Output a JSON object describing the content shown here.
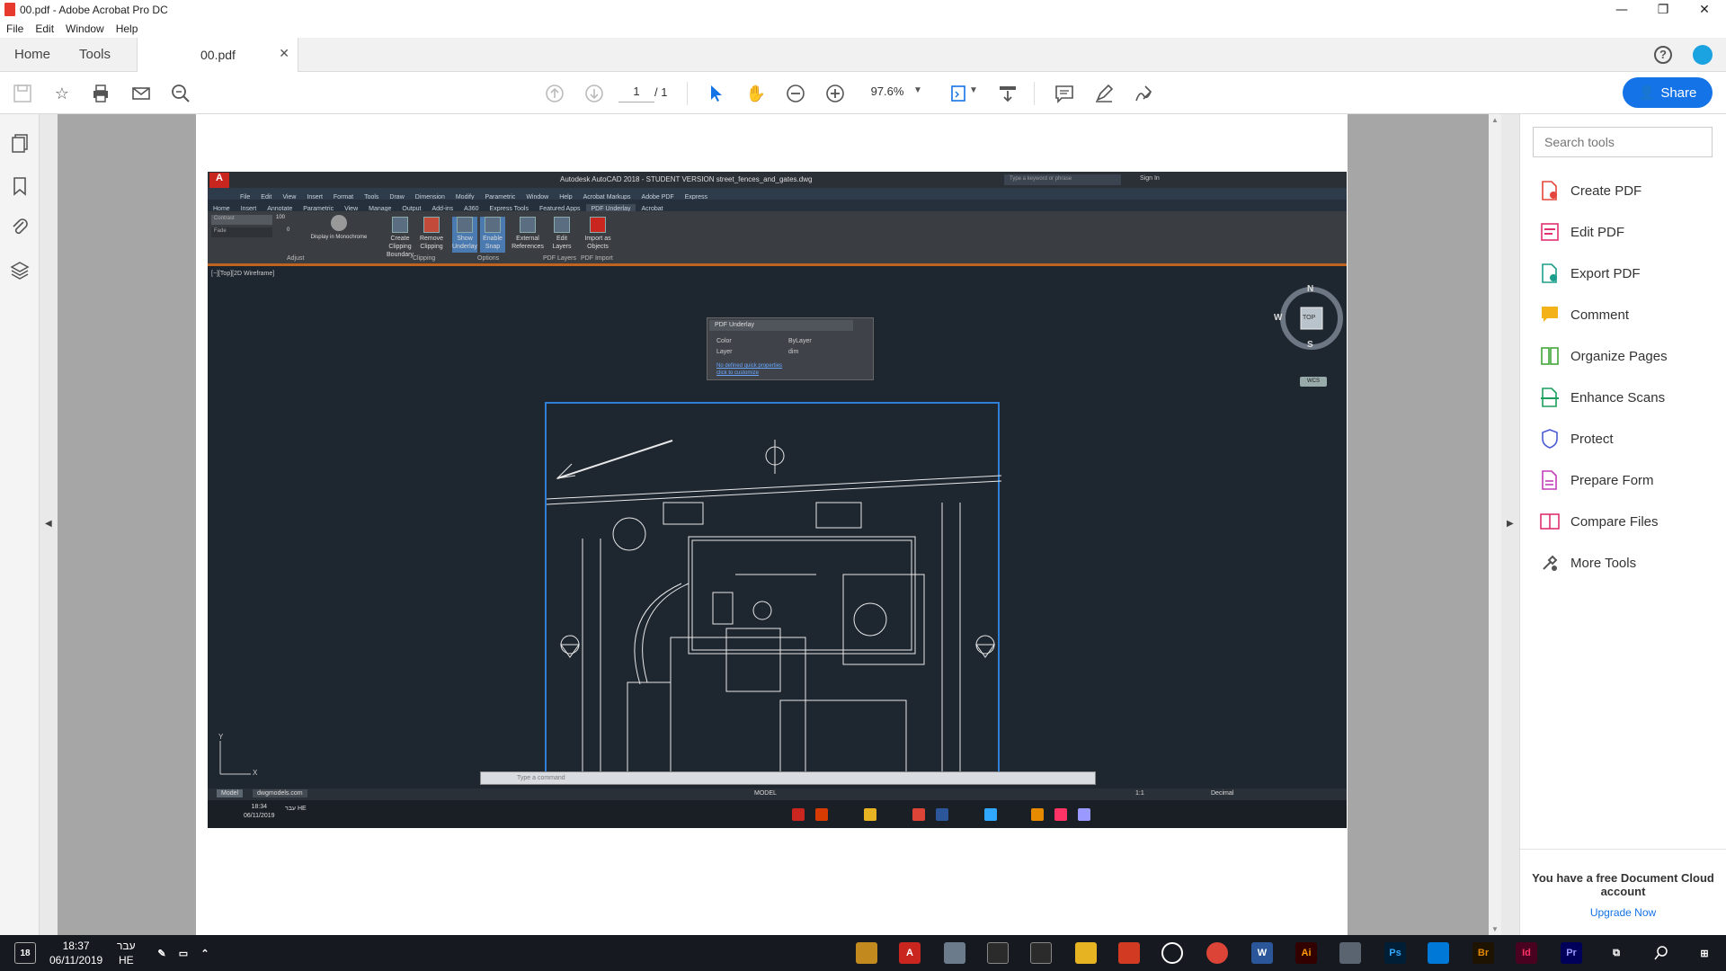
{
  "window": {
    "title": "00.pdf - Adobe Acrobat Pro DC"
  },
  "menu": [
    "File",
    "Edit",
    "Window",
    "Help"
  ],
  "tabs": {
    "home": "Home",
    "tools": "Tools",
    "document": "00.pdf"
  },
  "toolbar": {
    "page_current": "1",
    "page_total": "/ 1",
    "zoom": "97.6%",
    "share_label": "Share"
  },
  "tools_pane": {
    "search_placeholder": "Search tools",
    "items": [
      {
        "label": "Create PDF",
        "color": "#e4453a"
      },
      {
        "label": "Edit PDF",
        "color": "#e0306f"
      },
      {
        "label": "Export PDF",
        "color": "#1b9e8c"
      },
      {
        "label": "Comment",
        "color": "#f3b217"
      },
      {
        "label": "Organize Pages",
        "color": "#41a63a"
      },
      {
        "label": "Enhance Scans",
        "color": "#1b9e5c"
      },
      {
        "label": "Protect",
        "color": "#4a5bd6"
      },
      {
        "label": "Prepare Form",
        "color": "#c13fb8"
      },
      {
        "label": "Compare Files",
        "color": "#e0306f"
      },
      {
        "label": "More Tools",
        "color": "#555555"
      }
    ],
    "cloud_message": "You have a free Document Cloud account",
    "upgrade_label": "Upgrade Now"
  },
  "embedded_autocad": {
    "title": "Autodesk AutoCAD 2018 - STUDENT VERSION   street_fences_and_gates.dwg",
    "search_placeholder": "Type a keyword or phrase",
    "sign_in": "Sign In",
    "menu": [
      "File",
      "Edit",
      "View",
      "Insert",
      "Format",
      "Tools",
      "Draw",
      "Dimension",
      "Modify",
      "Parametric",
      "Window",
      "Help",
      "Acrobat Markups",
      "Adobe PDF",
      "Express"
    ],
    "ribbon_tabs": [
      "Home",
      "Insert",
      "Annotate",
      "Parametric",
      "View",
      "Manage",
      "Output",
      "Add-ins",
      "A360",
      "Express Tools",
      "Featured Apps",
      "PDF Underlay",
      "Acrobat"
    ],
    "adjust": {
      "contrast_label": "Contrast",
      "contrast_value": "100",
      "fade_label": "Fade",
      "fade_value": "0",
      "monochrome_label": "Display in Monochrome",
      "group": "Adjust"
    },
    "ribbon_buttons": [
      {
        "label": "Create Clipping Boundary"
      },
      {
        "label": "Remove Clipping"
      },
      {
        "label": "Show Underlay"
      },
      {
        "label": "Enable Snap"
      },
      {
        "label": "External References"
      },
      {
        "label": "Edit Layers"
      },
      {
        "label": "Import as Objects"
      }
    ],
    "ribbon_groups": [
      "Clipping",
      "Options",
      "PDF Layers",
      "PDF Import"
    ],
    "viewport_label": "[−][Top][2D Wireframe]",
    "panel": {
      "title": "PDF Underlay",
      "color_label": "Color",
      "color_value": "ByLayer",
      "layer_label": "Layer",
      "layer_value": "dim",
      "link1": "No defined quick properties",
      "link2": "click to customize"
    },
    "viewcube": {
      "n": "N",
      "s": "S",
      "w": "W",
      "top": "TOP",
      "wcs": "WCS"
    },
    "ucs": {
      "y": "Y",
      "x": "X"
    },
    "command_placeholder": "Type a command",
    "layout_tabs": [
      "Model",
      "dwgmodels.com"
    ],
    "status": {
      "model": "MODEL",
      "units": "Decimal",
      "scale": "1:1"
    },
    "taskbar_time": "18:34",
    "taskbar_date": "06/11/2019",
    "taskbar_lang": "עבר HE"
  },
  "taskbar": {
    "time": "18:37",
    "date": "06/11/2019",
    "lang1": "עבר",
    "lang2": "HE",
    "notifications": "18",
    "app_labels": {
      "illustrator": "Ai",
      "photoshop": "Ps",
      "bridge": "Br",
      "indesign": "Id",
      "premiere": "Pr"
    }
  }
}
